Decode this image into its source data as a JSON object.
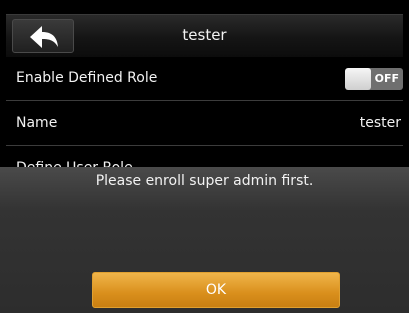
{
  "header": {
    "title": "tester",
    "back_icon": "back-arrow-icon"
  },
  "rows": [
    {
      "label": "Enable Defined Role",
      "toggle_state": "OFF"
    },
    {
      "label": "Name",
      "value": "tester"
    },
    {
      "label": "Define User Role"
    }
  ],
  "dialog": {
    "message": "Please enroll super admin first.",
    "ok_label": "OK"
  },
  "colors": {
    "accent": "#e49a24",
    "background": "#000000",
    "dialog": "#333333"
  }
}
